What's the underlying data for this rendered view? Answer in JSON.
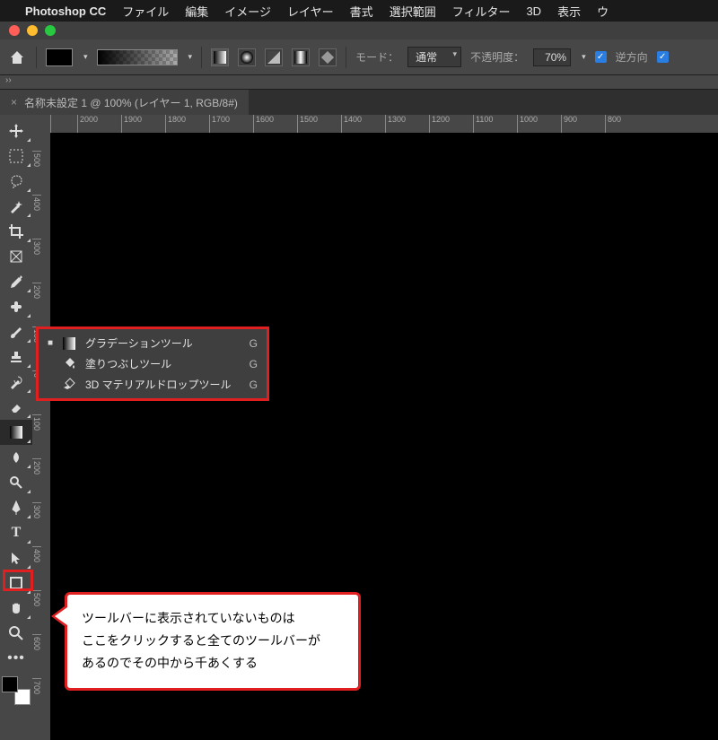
{
  "menubar": {
    "app": "Photoshop CC",
    "items": [
      "ファイル",
      "編集",
      "イメージ",
      "レイヤー",
      "書式",
      "選択範囲",
      "フィルター",
      "3D",
      "表示",
      "ウ"
    ]
  },
  "options": {
    "mode_label": "モード：",
    "mode_value": "通常",
    "opacity_label": "不透明度：",
    "opacity_value": "70%",
    "reverse_label": "逆方向"
  },
  "tab": {
    "close": "×",
    "title": "名称未設定 1 @ 100% (レイヤー 1, RGB/8#)"
  },
  "ruler_h": [
    "2000",
    "1900",
    "1800",
    "1700",
    "1600",
    "1500",
    "1400",
    "1300",
    "1200",
    "1100",
    "1000",
    "900",
    "800"
  ],
  "ruler_v": [
    "500",
    "400",
    "300",
    "200",
    "100",
    "0",
    "100",
    "200",
    "300",
    "400",
    "500",
    "600",
    "700"
  ],
  "flyout": {
    "items": [
      {
        "mark": "■",
        "icon": "gradient",
        "name": "グラデーションツール",
        "key": "G"
      },
      {
        "mark": "",
        "icon": "bucket",
        "name": "塗りつぶしツール",
        "key": "G"
      },
      {
        "mark": "",
        "icon": "drop3d",
        "name": "3D マテリアルドロップツール",
        "key": "G"
      }
    ]
  },
  "note": {
    "lines": [
      "ツールバーに表示されていないものは",
      "ここをクリックすると全てのツールバーが",
      "あるのでその中から千あくする"
    ]
  },
  "tools": [
    "move",
    "marquee",
    "lasso",
    "wand",
    "crop",
    "frame",
    "eyedrop",
    "heal",
    "brush",
    "stamp",
    "history",
    "eraser",
    "gradient",
    "blur",
    "dodge",
    "pen",
    "type",
    "path",
    "shape",
    "hand",
    "zoom",
    "more"
  ]
}
